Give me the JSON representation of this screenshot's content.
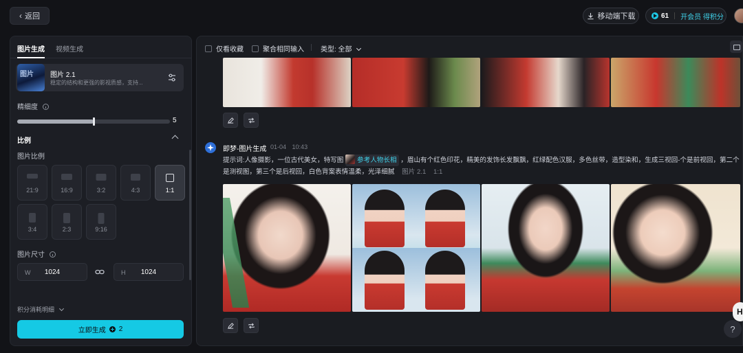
{
  "topbar": {
    "back_label": "返回",
    "download_label": "移动端下载",
    "credits": "61",
    "membership_link": "开会员 得积分"
  },
  "left_panel": {
    "tabs": [
      "图片生成",
      "视频生成"
    ],
    "active_tab": "图片生成",
    "model": {
      "thumb_text": "图片",
      "name": "图片 2.1",
      "description": "稳定的结构和更强的影视质感，支持..."
    },
    "detail_label": "精细度",
    "detail_value": "5",
    "detail_fraction": 0.5,
    "ratio_section_title": "比例",
    "ratio_sub_label": "图片比例",
    "ratios": [
      "21:9",
      "16:9",
      "3:2",
      "4:3",
      "1:1",
      "3:4",
      "2:3",
      "9:16"
    ],
    "selected_ratio": "1:1",
    "size_label": "图片尺寸",
    "width_prefix": "W",
    "width_value": "1024",
    "height_prefix": "H",
    "height_value": "1024",
    "cost_label": "积分消耗明细",
    "generate_label": "立即生成",
    "generate_cost": "2"
  },
  "right_panel": {
    "filter_favorites": "仅看收藏",
    "filter_merge": "聚合相同输入",
    "type_filter": "类型: 全部",
    "generation": {
      "title": "即梦-图片生成",
      "date": "01-04",
      "time": "10:43",
      "prompt_prefix": "提示词:人像摄影，一位古代美女，特写图",
      "reference_chip": "参考人物长相",
      "prompt_body": "，眉山有个红色印花，精美的发饰长发飘飘，红绿配色汉服，多色丝带，造型染和，生成三视回-个是前视回，第二个是测视图，第三个是后视回，白色背案表情温柔，光泽细腻",
      "model_tag": "图片 2.1",
      "ratio_tag": "1:1"
    }
  },
  "floating": {
    "help_label": "?",
    "h_badge": "H"
  },
  "colors": {
    "accent": "#15c9e4",
    "background": "#121317",
    "panel": "#1c1e24"
  }
}
